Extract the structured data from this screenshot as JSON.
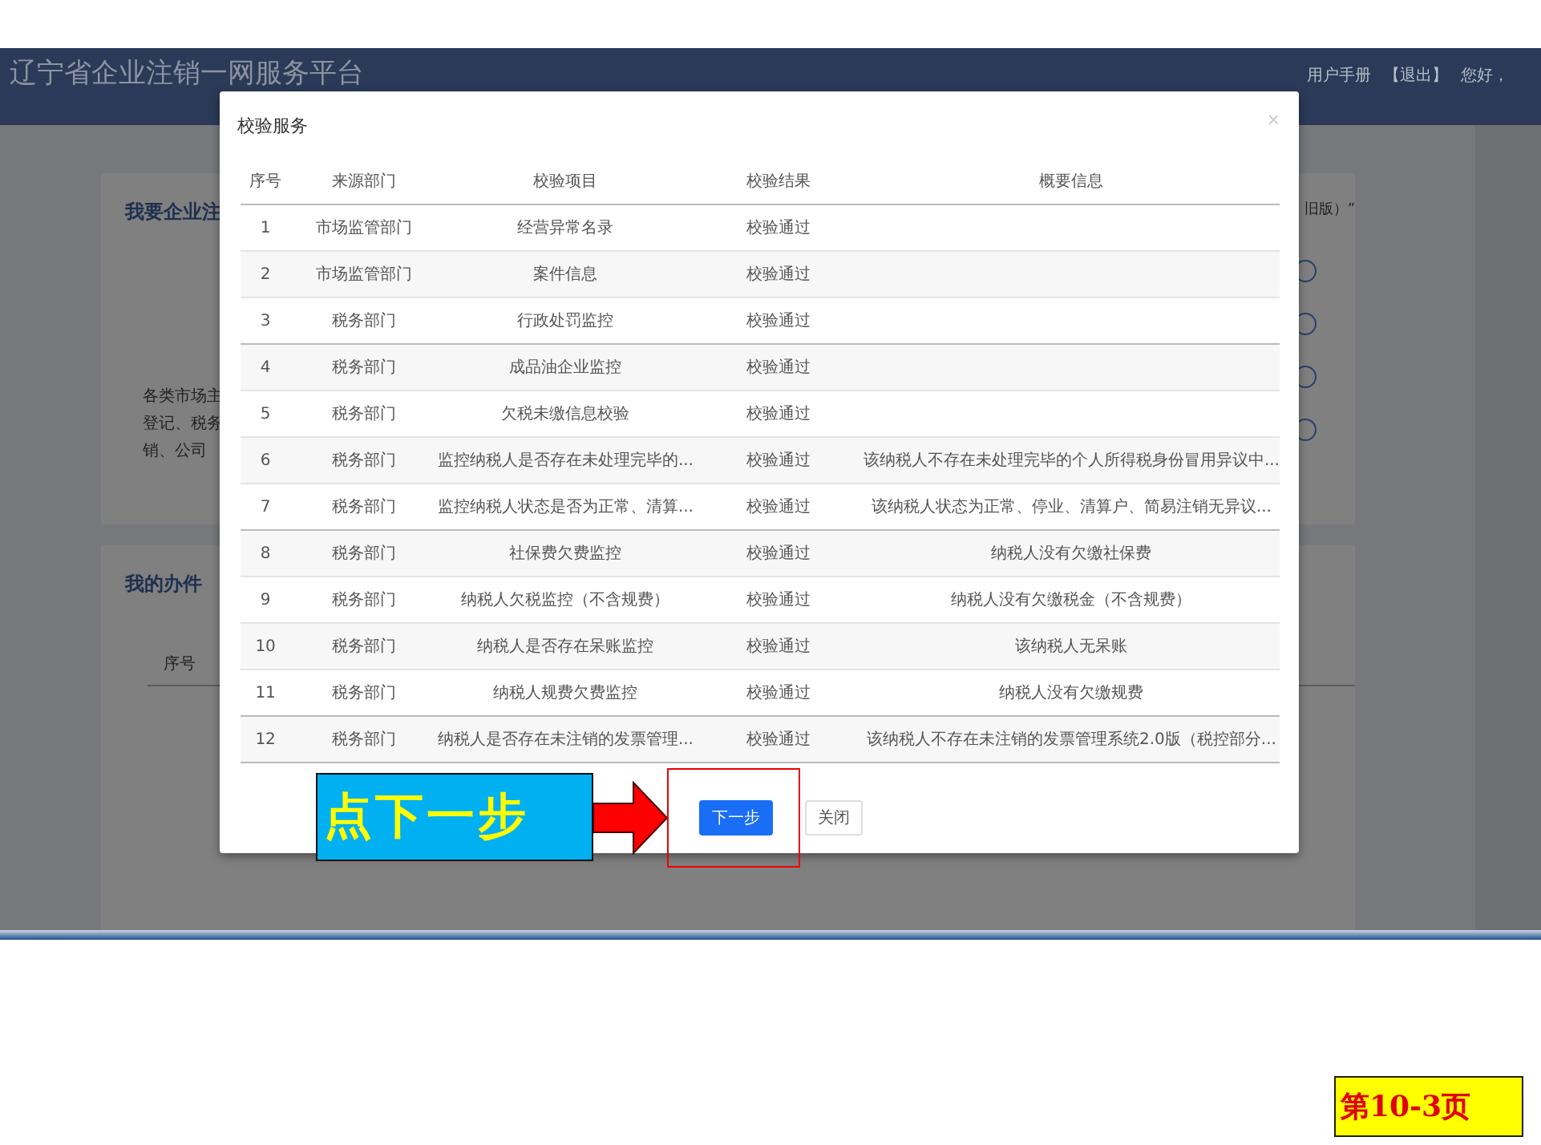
{
  "header": {
    "title": "辽宁省企业注销一网服务平台",
    "links": [
      "用户手册",
      "【退出】"
    ],
    "greeting": "您好，"
  },
  "cards": [
    {
      "title": "我要企业注",
      "side_label": "旧版）”",
      "lines": [
        "各类市场主",
        "登记、税务",
        "销、公司"
      ]
    },
    {
      "title": "我的办件",
      "column": "序号"
    }
  ],
  "dialog": {
    "title": "校验服务",
    "close": "×",
    "columns": [
      "序号",
      "来源部门",
      "校验项目",
      "校验结果",
      "概要信息"
    ],
    "rows": [
      [
        "1",
        "市场监管部门",
        "经营异常名录",
        "校验通过",
        ""
      ],
      [
        "2",
        "市场监管部门",
        "案件信息",
        "校验通过",
        ""
      ],
      [
        "3",
        "税务部门",
        "行政处罚监控",
        "校验通过",
        ""
      ],
      [
        "4",
        "税务部门",
        "成品油企业监控",
        "校验通过",
        ""
      ],
      [
        "5",
        "税务部门",
        "欠税未缴信息校验",
        "校验通过",
        ""
      ],
      [
        "6",
        "税务部门",
        "监控纳税人是否存在未处理完毕的...",
        "校验通过",
        "该纳税人不存在未处理完毕的个人所得税身份冒用异议中..."
      ],
      [
        "7",
        "税务部门",
        "监控纳税人状态是否为正常、清算...",
        "校验通过",
        "该纳税人状态为正常、停业、清算户、简易注销无异议..."
      ],
      [
        "8",
        "税务部门",
        "社保费欠费监控",
        "校验通过",
        "纳税人没有欠缴社保费"
      ],
      [
        "9",
        "税务部门",
        "纳税人欠税监控（不含规费）",
        "校验通过",
        "纳税人没有欠缴税金（不含规费）"
      ],
      [
        "10",
        "税务部门",
        "纳税人是否存在呆账监控",
        "校验通过",
        "该纳税人无呆账"
      ],
      [
        "11",
        "税务部门",
        "纳税人规费欠费监控",
        "校验通过",
        "纳税人没有欠缴规费"
      ],
      [
        "12",
        "税务部门",
        "纳税人是否存在未注销的发票管理...",
        "校验通过",
        "该纳税人不存在未注销的发票管理系统2.0版（税控部分..."
      ]
    ],
    "buttons": [
      {
        "label": "下一步",
        "kind": "primary"
      },
      {
        "label": "关闭",
        "kind": "default"
      }
    ]
  },
  "annotation": {
    "callout": "点下一步"
  },
  "page_label": "第10-3页"
}
